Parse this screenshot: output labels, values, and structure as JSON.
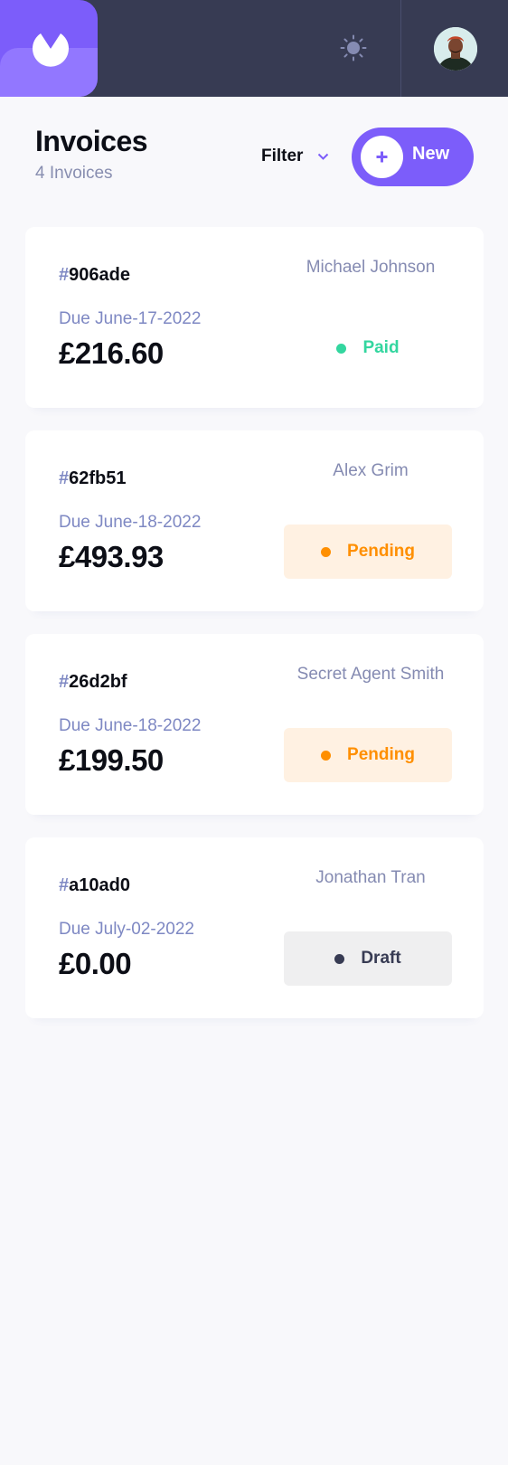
{
  "header": {
    "title": "Invoices",
    "count_label": "4 Invoices",
    "filter_label": "Filter",
    "new_button_label": "New"
  },
  "colors": {
    "accent": "#7C5DFA",
    "topbar": "#373B53",
    "paid": "#33D69F",
    "pending": "#FF8F00",
    "draft": "#373B53"
  },
  "icons": {
    "logo": "logo-icon",
    "theme": "sun-icon",
    "filter": "chevron-down-icon",
    "new": "plus-icon"
  },
  "invoices": [
    {
      "hash": "#",
      "id": "906ade",
      "client": "Michael Johnson",
      "due": "Due June-17-2022",
      "amount": "£216.60",
      "status": "Paid"
    },
    {
      "hash": "#",
      "id": "62fb51",
      "client": "Alex Grim",
      "due": "Due June-18-2022",
      "amount": "£493.93",
      "status": "Pending"
    },
    {
      "hash": "#",
      "id": "26d2bf",
      "client": "Secret Agent Smith",
      "due": "Due June-18-2022",
      "amount": "£199.50",
      "status": "Pending"
    },
    {
      "hash": "#",
      "id": "a10ad0",
      "client": "Jonathan Tran",
      "due": "Due July-02-2022",
      "amount": "£0.00",
      "status": "Draft"
    }
  ]
}
